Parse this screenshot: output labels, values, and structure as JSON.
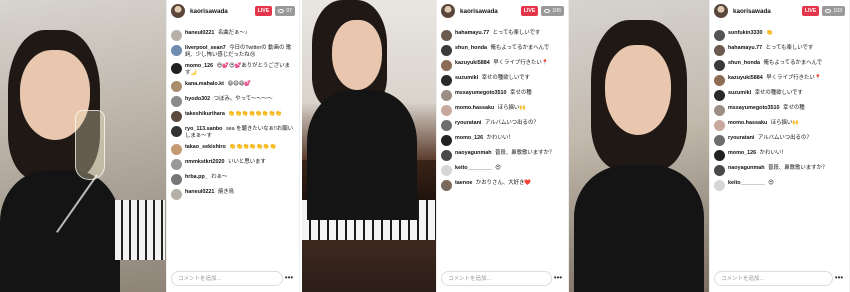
{
  "panels": [
    {
      "username": "kaorisawada",
      "live_label": "LIVE",
      "viewers": "97",
      "comment_placeholder": "コメントを追加...",
      "more_label": "•••",
      "comments": [
        {
          "user": "haneul0221",
          "text": "名曲だぁ〜♪",
          "color": "#b7b0a6"
        },
        {
          "user": "liverpool_sean7",
          "text": "今日のTwitterの 動画の 歌詞、少し怖い感じだったね😣",
          "color": "#6f8bb0"
        },
        {
          "user": "momo_126",
          "text": "😍💕😍💕ありがとうございます🌙",
          "color": "#222"
        },
        {
          "user": "kana.mahalo.kt",
          "text": "😄😄😄💕",
          "color": "#a98d6d"
        },
        {
          "user": "hyodo302",
          "text": "つぼみ。やって〜〜〜〜",
          "color": "#8a8a8a"
        },
        {
          "user": "takeshikurihara",
          "text": "👏👏👏👏👏👏👏👏",
          "color": "#5b4a3e"
        },
        {
          "user": "ryo_113.sanbo",
          "text": "sea を聴きたいなぁ!!お願いしまぁ〜す",
          "color": "#333"
        },
        {
          "user": "takao_sekishiro",
          "text": "👏👏👏👏👏👏👏",
          "color": "#c49a72"
        },
        {
          "user": "nmmkstkrt2020",
          "text": "いいと思います",
          "color": "#999"
        },
        {
          "user": "hrba.pp_",
          "text": "わぁ〜",
          "color": "#777"
        },
        {
          "user": "haneul0221",
          "text": "焼き鳥",
          "color": "#b7b0a6"
        }
      ]
    },
    {
      "username": "kaorisawada",
      "live_label": "LIVE",
      "viewers": "106",
      "comment_placeholder": "コメントを追加...",
      "more_label": "•••",
      "comments": [
        {
          "user": "hahamayu.77",
          "text": "とっても楽しいです",
          "color": "#6a5a50"
        },
        {
          "user": "shun_honda",
          "text": "俺もよってるかまへんで",
          "color": "#3a3a3a"
        },
        {
          "user": "kazuyuki5884",
          "text": "早くライブ行きたい📍",
          "color": "#8c6c55"
        },
        {
          "user": "suzumikl",
          "text": "幸せの種欲しいです",
          "color": "#2a2a2a"
        },
        {
          "user": "mssayumegoto3510",
          "text": "幸せの種",
          "color": "#9c8e86"
        },
        {
          "user": "momo.hassaku",
          "text": "ほら揺い🙌",
          "color": "#c9a8a0"
        },
        {
          "user": "ryouratani",
          "text": "アルバムいつ出るの？",
          "color": "#6e6e6e"
        },
        {
          "user": "momo_126",
          "text": "かわいい！",
          "color": "#222"
        },
        {
          "user": "naoyagunmah",
          "text": "普段、鼻歌歌いますか？",
          "color": "#4a4a4a"
        },
        {
          "user": "keito________",
          "text": "😍",
          "color": "#d6d6d6"
        },
        {
          "user": "taenoe",
          "text": "かおりさん、大好き❤️",
          "color": "#7a6a5e"
        }
      ]
    },
    {
      "username": "kaorisawada",
      "live_label": "LIVE",
      "viewers": "103",
      "comment_placeholder": "コメントを追加...",
      "more_label": "•••",
      "comments": [
        {
          "user": "sunfukin3330",
          "text": "👏",
          "color": "#555"
        },
        {
          "user": "hahamayu.77",
          "text": "とっても楽しいです",
          "color": "#6a5a50"
        },
        {
          "user": "shun_honda",
          "text": "俺もよってるかまへんで",
          "color": "#3a3a3a"
        },
        {
          "user": "kazuyuki5884",
          "text": "早くライブ行きたい📍",
          "color": "#8c6c55"
        },
        {
          "user": "suzumikl",
          "text": "幸せの種欲しいです",
          "color": "#2a2a2a"
        },
        {
          "user": "mssayumegoto3510",
          "text": "幸せの種",
          "color": "#9c8e86"
        },
        {
          "user": "momo.hassaku",
          "text": "ほら揺い🙌",
          "color": "#c9a8a0"
        },
        {
          "user": "ryouratani",
          "text": "アルバムいつ出るの？",
          "color": "#6e6e6e"
        },
        {
          "user": "momo_126",
          "text": "かわいい！",
          "color": "#222"
        },
        {
          "user": "naoyagunmah",
          "text": "普段、鼻歌歌いますか？",
          "color": "#4a4a4a"
        },
        {
          "user": "keito________",
          "text": "😍",
          "color": "#d6d6d6"
        }
      ]
    }
  ]
}
